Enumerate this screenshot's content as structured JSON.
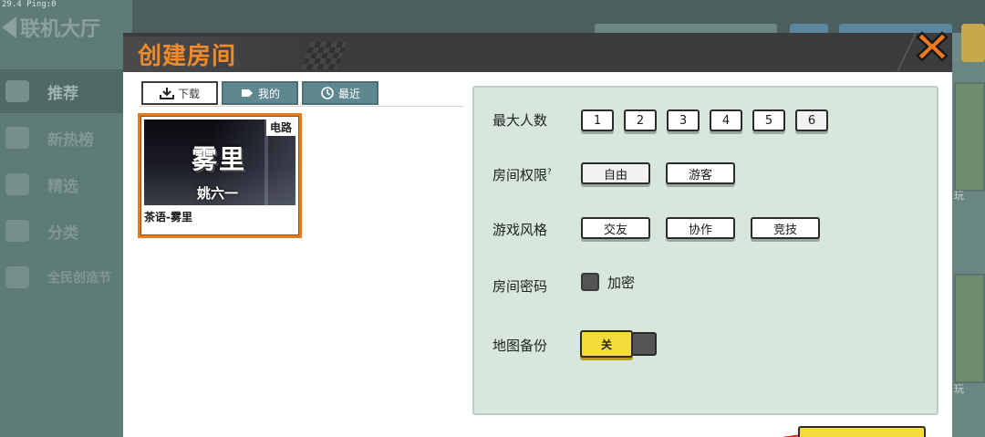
{
  "status_bar": {
    "text": "29.4  Ping:0"
  },
  "background": {
    "back_label": "联机大厅",
    "menu": [
      {
        "label": "推荐",
        "active": true
      },
      {
        "label": "新热榜",
        "active": false
      },
      {
        "label": "精选",
        "active": false
      },
      {
        "label": "分类",
        "active": false
      },
      {
        "label": "全民创造节",
        "active": false
      }
    ],
    "right_labels": [
      "玩",
      "玩"
    ]
  },
  "dialog": {
    "title": "创建房间",
    "close_icon": "close-icon"
  },
  "tabs": [
    {
      "label": "下载",
      "icon": "download-icon",
      "active": true
    },
    {
      "label": "我的",
      "icon": "tag-icon",
      "active": false
    },
    {
      "label": "最近",
      "icon": "history-icon",
      "active": false
    }
  ],
  "map": {
    "thumb_title": "雾里",
    "thumb_author": "姚六一",
    "tag": "电路",
    "name": "茶语-雾里"
  },
  "settings": {
    "max_players": {
      "label": "最大人数",
      "options": [
        "1",
        "2",
        "3",
        "4",
        "5",
        "6"
      ],
      "selected": "6"
    },
    "permission": {
      "label": "房间权限",
      "info_mark": "?",
      "options": [
        "自由",
        "游客"
      ],
      "selected": "自由"
    },
    "style": {
      "label": "游戏风格",
      "options": [
        "交友",
        "协作",
        "竞技"
      ]
    },
    "password": {
      "label": "房间密码",
      "checkbox_label": "加密",
      "checked": false
    },
    "backup": {
      "label": "地图备份",
      "toggle_label": "关",
      "on": false
    }
  },
  "colors": {
    "title_orange": "#f18a2a",
    "header_dark": "#3b3c3e",
    "panel_green": "#d7e7dc",
    "tab_teal": "#5f8790",
    "toggle_yellow": "#f5dc3c",
    "card_border": "#e27c1f"
  }
}
